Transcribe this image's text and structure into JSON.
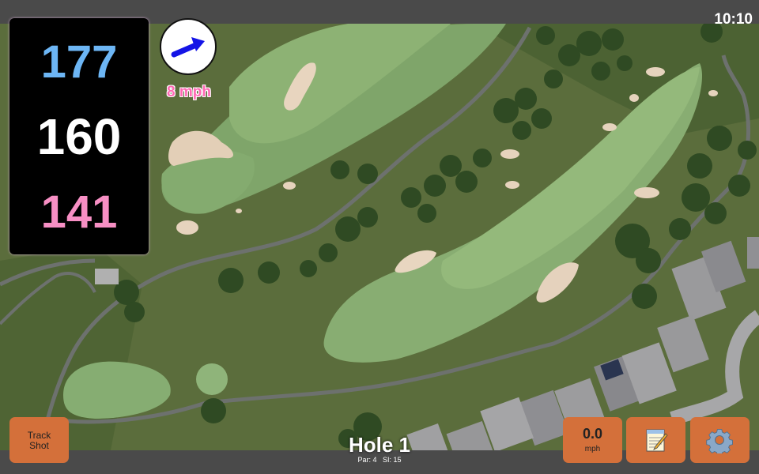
{
  "status_bar": {
    "time": "10:10"
  },
  "yardage": {
    "back": "177",
    "middle": "160",
    "front": "141",
    "colors": {
      "back": "#6db6f5",
      "middle": "#ffffff",
      "front": "#f78fc4"
    }
  },
  "wind": {
    "speed": "8 mph",
    "arrow_color": "#1414e6",
    "icon": "wind-arrow-icon"
  },
  "buttons": {
    "track_shot": {
      "line1": "Track",
      "line2": "Shot"
    },
    "speed": {
      "value": "0.0",
      "unit": "mph"
    },
    "scorecard": {
      "icon": "notepad-icon"
    },
    "settings": {
      "icon": "gear-icon"
    }
  },
  "hole": {
    "title": "Hole 1",
    "par": "Par: 4",
    "stroke_index": "SI: 15"
  },
  "colors": {
    "accent": "#d4703a",
    "bar": "#4a4a4a"
  }
}
